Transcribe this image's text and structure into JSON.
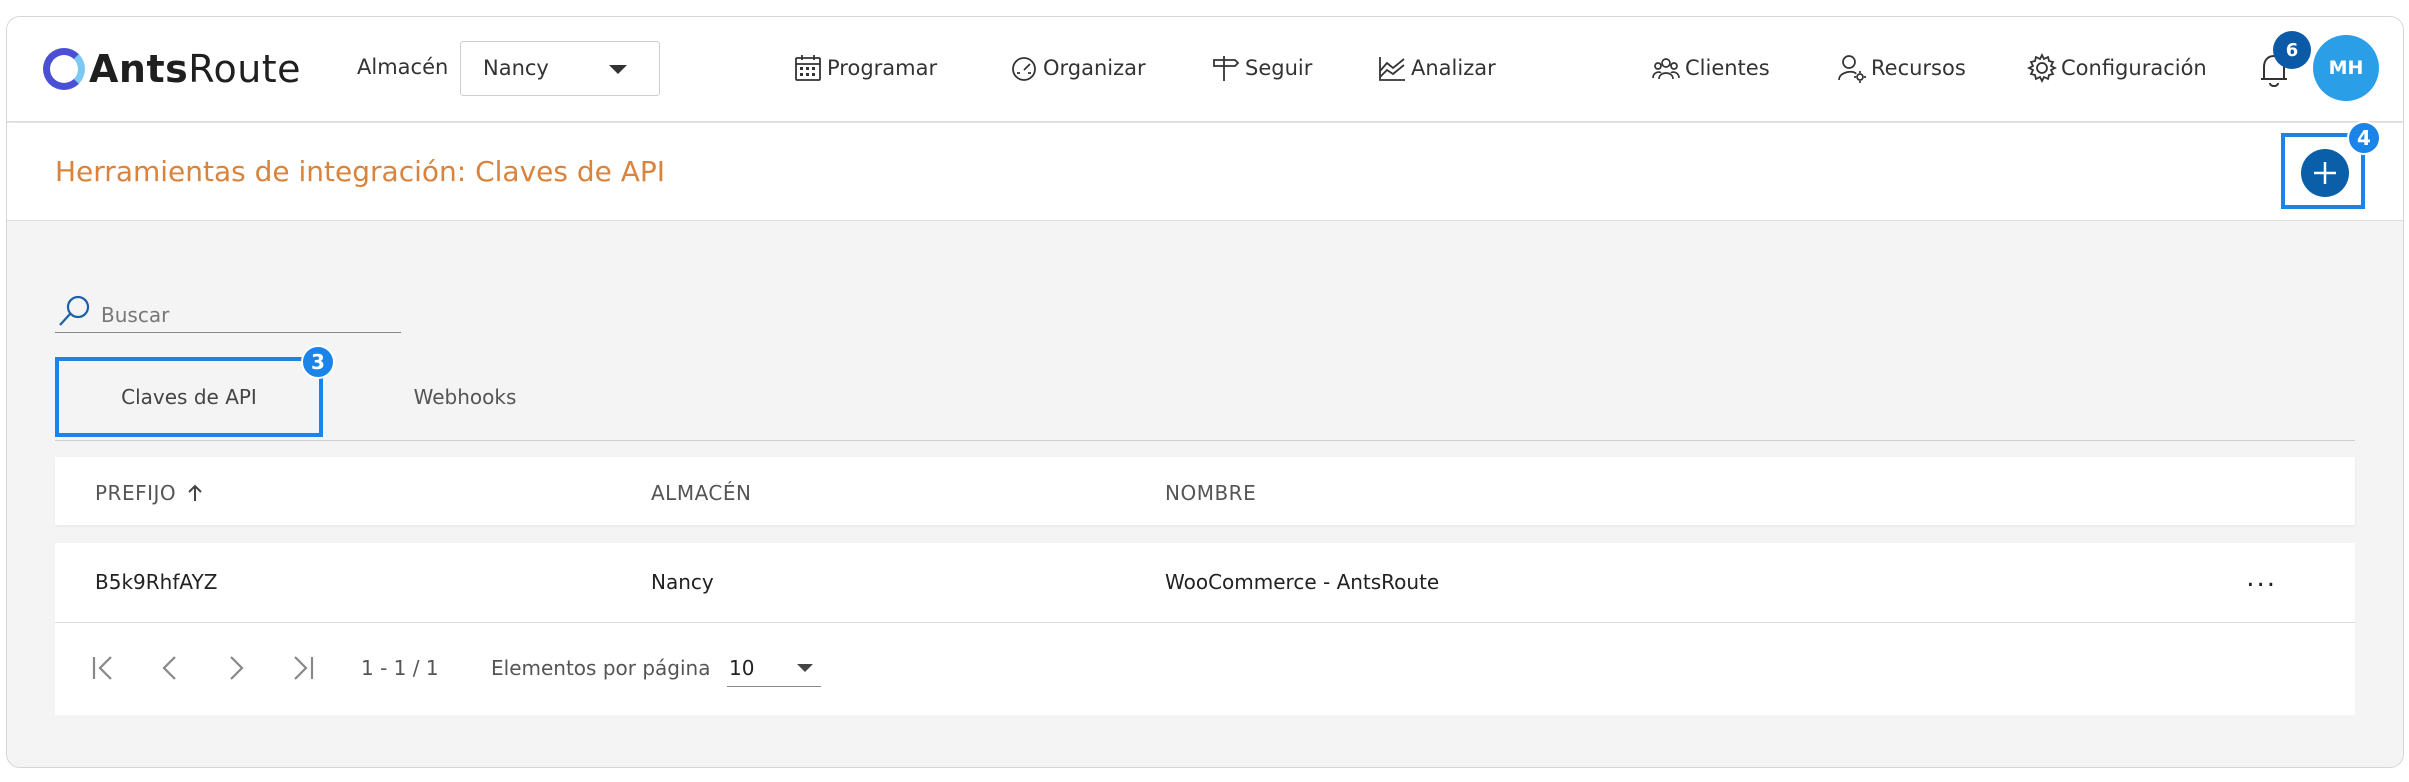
{
  "brand": {
    "name_bold": "Ants",
    "name_light": "Route"
  },
  "header": {
    "warehouse_label": "Almacén",
    "warehouse_value": "Nancy",
    "nav": [
      {
        "label": "Programar",
        "icon": "calendar-icon"
      },
      {
        "label": "Organizar",
        "icon": "gauge-icon"
      },
      {
        "label": "Seguir",
        "icon": "signpost-icon"
      },
      {
        "label": "Analizar",
        "icon": "chart-icon"
      }
    ],
    "right_nav": [
      {
        "label": "Clientes",
        "icon": "users-icon"
      },
      {
        "label": "Recursos",
        "icon": "user-gear-icon"
      },
      {
        "label": "Configuración",
        "icon": "gear-icon"
      }
    ],
    "notifications_count": "6",
    "avatar_initials": "MH"
  },
  "page": {
    "title": "Herramientas de integración: Claves de API",
    "add_step_badge": "4"
  },
  "search": {
    "placeholder": "Buscar"
  },
  "tabs": [
    {
      "label": "Claves de API",
      "active": true,
      "step_badge": "3"
    },
    {
      "label": "Webhooks",
      "active": false
    }
  ],
  "table": {
    "columns": [
      "PREFIJO",
      "ALMACÉN",
      "NOMBRE"
    ],
    "rows": [
      {
        "prefix": "B5k9RhfAYZ",
        "warehouse": "Nancy",
        "name": "WooCommerce - AntsRoute",
        "menu": "..."
      }
    ]
  },
  "pagination": {
    "range": "1 - 1 / 1",
    "per_page_label": "Elementos por página",
    "per_page_value": "10"
  },
  "colors": {
    "accent": "#1a84e8",
    "primary": "#0b5ea8",
    "title": "#d9833c",
    "avatar": "#2b9ee8"
  }
}
